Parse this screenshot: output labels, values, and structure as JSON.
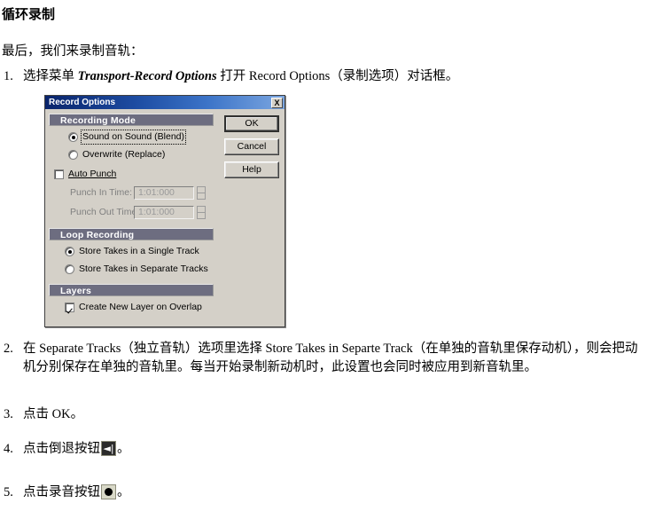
{
  "document": {
    "title": "循环录制",
    "intro": "最后，我们来录制音轨：",
    "steps": [
      {
        "num": "1.",
        "text_before": "选择菜单 ",
        "emphasis": "Transport-Record Options",
        "text_after": " 打开 Record Options（录制选项）对话框。"
      },
      {
        "num": "2.",
        "text": "在 Separate Tracks（独立音轨）选项里选择 Store Takes in Separte Track（在单独的音轨里保存动机），则会把动机分别保存在单独的音轨里。每当开始录制新动机时，此设置也会同时被应用到新音轨里。"
      },
      {
        "num": "3.",
        "text": "点击 OK。"
      },
      {
        "num": "4.",
        "text_before": "点击倒退按钮",
        "icon": "rewind-icon",
        "text_after": "。"
      },
      {
        "num": "5.",
        "text_before": "点击录音按钮",
        "icon": "record-icon",
        "text_after": "。"
      }
    ]
  },
  "dialog": {
    "title": "Record Options",
    "close_label": "X",
    "sections": {
      "recording_mode": {
        "header": "Recording Mode",
        "options": [
          {
            "label": "Sound on Sound (Blend)",
            "selected": true,
            "focused": true
          },
          {
            "label": "Overwrite (Replace)",
            "selected": false,
            "focused": false
          }
        ]
      },
      "auto_punch": {
        "label": "Auto Punch",
        "checked": false,
        "fields": [
          {
            "label": "Punch In Time:",
            "value": "1:01:000",
            "disabled": true
          },
          {
            "label": "Punch Out Time:",
            "value": "1:01:000",
            "disabled": true
          }
        ]
      },
      "loop_recording": {
        "header": "Loop Recording",
        "options": [
          {
            "label": "Store Takes in a Single Track",
            "selected": true
          },
          {
            "label": "Store Takes in Separate Tracks",
            "selected": false
          }
        ]
      },
      "layers": {
        "header": "Layers",
        "options": [
          {
            "label": "Create New Layer on Overlap",
            "checked": true
          }
        ]
      }
    },
    "buttons": [
      {
        "label": "OK",
        "default": true
      },
      {
        "label": "Cancel",
        "default": false
      },
      {
        "label": "Help",
        "default": false
      }
    ],
    "colors": {
      "titlebar_start": "#09246b",
      "titlebar_end": "#7ba6e0",
      "section_header_bg": "#6d6d80",
      "face": "#d4d0c8"
    }
  }
}
